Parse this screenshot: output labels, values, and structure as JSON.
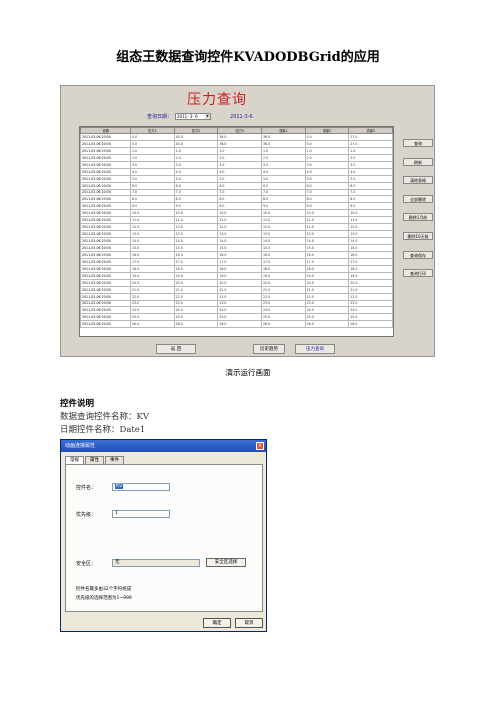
{
  "doc": {
    "title": "组态王数据查询控件KVADODBGrid的应用",
    "caption": "演示运行画面",
    "section_heading": "控件说明",
    "line1": "数据查询控件名称：KV",
    "line2": "日期控件名称：Date1"
  },
  "app": {
    "title": "压力查询",
    "query_label": "查询日期：",
    "date_value": "2011- 3- 6",
    "today": "2011-3-6",
    "columns": [
      "日期",
      "压力1",
      "压力2",
      "压力3",
      "流量1",
      "流量2",
      "流量3"
    ],
    "rows": [
      [
        "2011-03-06 20:00",
        "0.0",
        "40.0",
        "36.0",
        "36.0",
        "0.0",
        "27.0"
      ],
      [
        "2011-03-06 20:00",
        "0.0",
        "40.0",
        "36.0",
        "36.0",
        "0.0",
        "27.0"
      ],
      [
        "2011-03-06 20:00",
        "1.0",
        "1.0",
        "1.0",
        "1.0",
        "1.0",
        "1.0"
      ],
      [
        "2011-03-06 20:00",
        "2.0",
        "2.0",
        "2.0",
        "2.0",
        "2.0",
        "2.0"
      ],
      [
        "2011-03-06 20:00",
        "3.0",
        "3.0",
        "3.0",
        "3.0",
        "3.0",
        "3.0"
      ],
      [
        "2011-03-06 20:00",
        "4.0",
        "4.0",
        "4.0",
        "4.0",
        "4.0",
        "4.0"
      ],
      [
        "2011-03-06 20:00",
        "5.0",
        "5.0",
        "5.0",
        "5.0",
        "5.0",
        "5.0"
      ],
      [
        "2011-03-06 20:00",
        "6.0",
        "6.0",
        "6.0",
        "6.0",
        "6.0",
        "6.0"
      ],
      [
        "2011-03-06 20:00",
        "7.0",
        "7.0",
        "7.0",
        "7.0",
        "7.0",
        "7.0"
      ],
      [
        "2011-03-06 20:00",
        "8.0",
        "8.0",
        "8.0",
        "8.0",
        "8.0",
        "8.0"
      ],
      [
        "2011-03-06 20:00",
        "9.0",
        "9.0",
        "9.0",
        "9.0",
        "9.0",
        "9.0"
      ],
      [
        "2011-03-06 20:00",
        "10.0",
        "10.0",
        "10.0",
        "10.0",
        "10.0",
        "10.0"
      ],
      [
        "2011-03-06 20:00",
        "11.0",
        "11.0",
        "11.0",
        "11.0",
        "11.0",
        "11.0"
      ],
      [
        "2011-03-06 20:00",
        "12.0",
        "12.0",
        "12.0",
        "12.0",
        "12.0",
        "12.0"
      ],
      [
        "2011-03-06 20:00",
        "13.0",
        "13.0",
        "13.0",
        "13.0",
        "13.0",
        "13.0"
      ],
      [
        "2011-03-06 20:00",
        "14.0",
        "14.0",
        "14.0",
        "14.0",
        "14.0",
        "14.0"
      ],
      [
        "2011-03-06 20:00",
        "15.0",
        "15.0",
        "15.0",
        "15.0",
        "15.0",
        "15.0"
      ],
      [
        "2011-03-06 20:00",
        "16.0",
        "16.0",
        "16.0",
        "16.0",
        "16.0",
        "16.0"
      ],
      [
        "2011-03-06 20:00",
        "17.0",
        "17.0",
        "17.0",
        "17.0",
        "17.0",
        "17.0"
      ],
      [
        "2011-03-06 20:00",
        "18.0",
        "18.0",
        "18.0",
        "18.0",
        "18.0",
        "18.0"
      ],
      [
        "2011-03-06 20:00",
        "19.0",
        "19.0",
        "19.0",
        "19.0",
        "19.0",
        "19.0"
      ],
      [
        "2011-03-06 20:00",
        "20.0",
        "20.0",
        "20.0",
        "20.0",
        "20.0",
        "20.0"
      ],
      [
        "2011-03-06 20:00",
        "21.0",
        "21.0",
        "21.0",
        "21.0",
        "21.0",
        "21.0"
      ],
      [
        "2011-03-06 20:00",
        "22.0",
        "22.0",
        "22.0",
        "22.0",
        "22.0",
        "22.0"
      ],
      [
        "2011-03-06 20:00",
        "23.0",
        "23.0",
        "23.0",
        "23.0",
        "23.0",
        "23.0"
      ],
      [
        "2011-03-06 20:00",
        "24.0",
        "24.0",
        "24.0",
        "24.0",
        "24.0",
        "24.0"
      ],
      [
        "2011-03-06 20:00",
        "25.0",
        "25.0",
        "25.0",
        "25.0",
        "25.0",
        "25.0"
      ],
      [
        "2011-03-06 20:00",
        "26.0",
        "26.0",
        "26.0",
        "26.0",
        "26.0",
        "26.0"
      ]
    ],
    "side_buttons": [
      "查询",
      "刷新",
      "清除表格",
      "全部删除",
      "删除1月前",
      "删除10天前",
      "查询保存",
      "查询打印"
    ],
    "bottom_buttons": [
      "返 回",
      "历史趋势",
      "压力查询"
    ],
    "colors": {
      "title": "#cc2020",
      "query": "#2020a0",
      "panel": "#d8d4cc"
    }
  },
  "dialog": {
    "title": "动画连接属性",
    "close": "×",
    "tabs": [
      "常规",
      "属性",
      "事件"
    ],
    "name_label": "控件名：",
    "name_value": "KV",
    "priority_label": "优先级：",
    "priority_value": "1",
    "security_label": "安全区：",
    "security_value": "无",
    "security_button": "安全区选择",
    "note1": "控件名最多由32个字符组成",
    "note2": "优先级的选择范围为1~999",
    "ok": "确定",
    "cancel": "取消"
  }
}
